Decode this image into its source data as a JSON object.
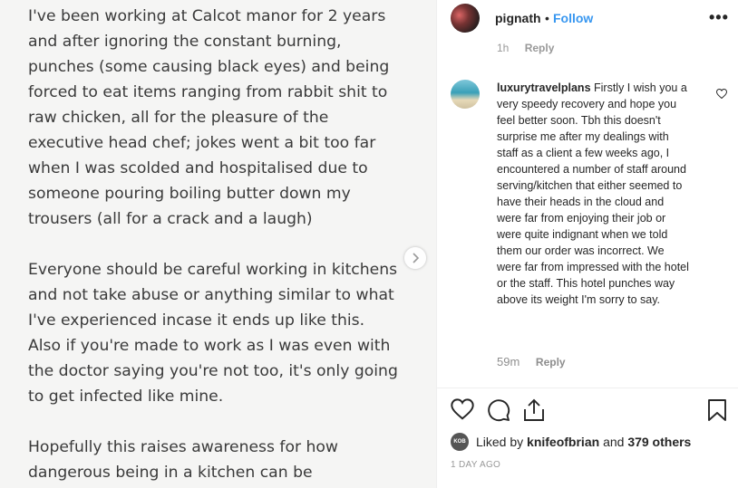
{
  "post": {
    "paragraphs": [
      "I've been working at Calcot manor for 2 years\nand after ignoring the constant burning,\npunches (some causing black eyes) and being\nforced to eat items ranging from rabbit shit to\nraw chicken, all for the pleasure of the\nexecutive head chef; jokes went a bit too far\nwhen I was scolded and hospitalised due to\nsomeone pouring boiling butter down my\ntrousers (all for a crack and a laugh)",
      "Everyone should be careful working in kitchens\nand not take abuse or anything similar to what\nI've experienced incase it ends up like this.\nAlso if you're made to work as I was even with\nthe doctor saying you're not too, it's only going\nto get infected like mine.",
      "Hopefully this raises awareness for how\ndangerous being in a kitchen can be"
    ],
    "next_icon": "chevron-right-icon"
  },
  "header": {
    "username": "pignath",
    "separator": "•",
    "follow_label": "Follow",
    "more_label": "•••"
  },
  "prev_comment_meta": {
    "time": "1h",
    "reply_label": "Reply"
  },
  "comment": {
    "username": "luxurytravelplans",
    "text": "Firstly I wish you a very speedy recovery and hope you feel better soon. Tbh this doesn't surprise me after my dealings with staff as a client a few weeks ago, I encountered a number of staff around serving/kitchen that either seemed to have their heads in the cloud and were far from enjoying their job or were quite indignant when we told them our order was incorrect. We were far from impressed with the hotel or the staff. This hotel punches way above its weight I'm sorry to say.",
    "time": "59m",
    "reply_label": "Reply"
  },
  "likes": {
    "avatar_text": "KOB",
    "prefix": "Liked by",
    "user": "knifeofbrian",
    "middle": "and",
    "count": "379 others"
  },
  "date": "1 DAY AGO",
  "colors": {
    "link": "#3897f0",
    "text": "#262626",
    "muted": "#8e8e8e"
  }
}
